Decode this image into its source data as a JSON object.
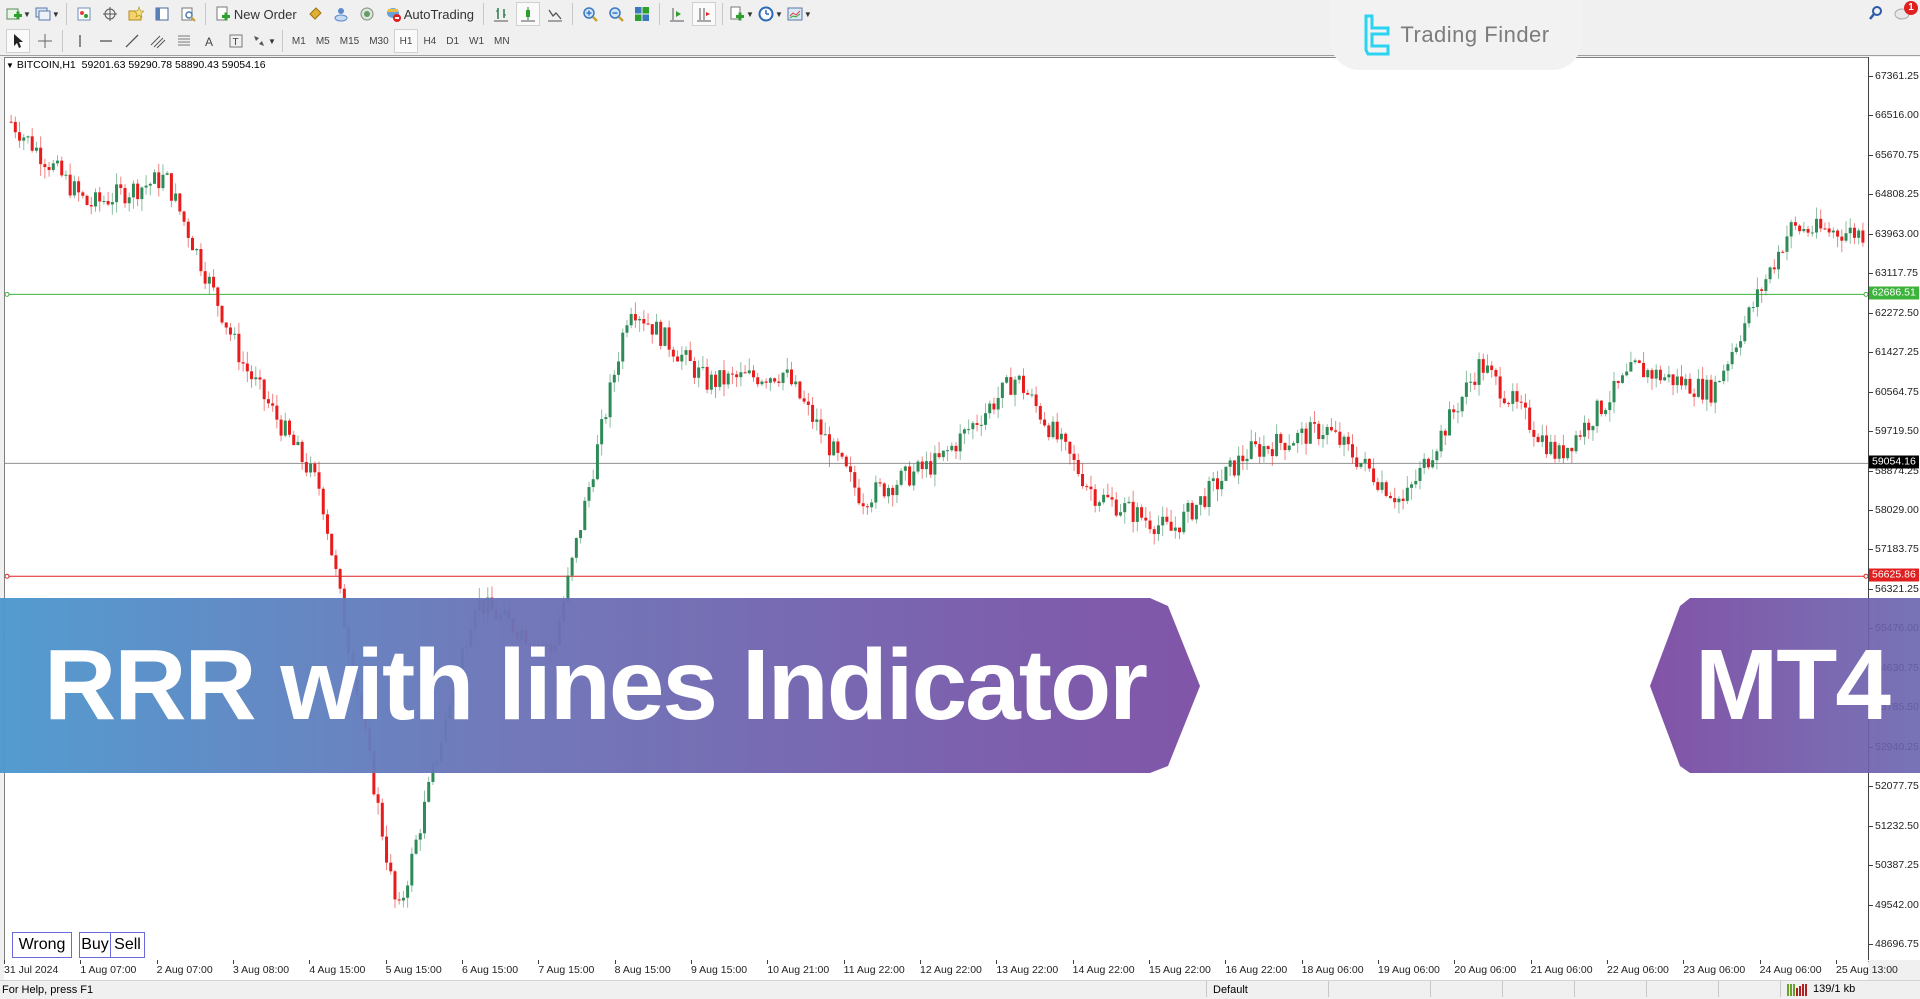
{
  "toolbar": {
    "new_order_label": "New Order",
    "autotrading_label": "AutoTrading",
    "row1_icons": [
      "new-chart-icon",
      "profiles-icon",
      "market-watch-icon",
      "navigator-icon",
      "data-window-icon",
      "terminal-icon",
      "strategy-tester-icon"
    ],
    "row1_right_icons": [
      "bar-chart-icon",
      "candlestick-icon",
      "line-chart-icon",
      "zoom-in-icon",
      "zoom-out-icon",
      "tile-windows-icon",
      "chart-shift-icon",
      "auto-scroll-icon",
      "indicators-icon",
      "periods-icon",
      "templates-icon"
    ],
    "drawing_tools": [
      "cursor-icon",
      "crosshair-icon",
      "vertical-line-icon",
      "horizontal-line-icon",
      "trendline-icon",
      "fibonacci-icon",
      "equidistant-channel-icon",
      "text-icon",
      "text-label-icon",
      "arrows-icon"
    ],
    "timeframes": [
      "M1",
      "M5",
      "M15",
      "M30",
      "H1",
      "H4",
      "D1",
      "W1",
      "MN"
    ],
    "active_timeframe": "H1"
  },
  "branding": {
    "name": "Trading Finder"
  },
  "notifications": {
    "count": "1"
  },
  "chart": {
    "symbol": "BITCOIN,H1",
    "ohlc": "59201.63 59290.78 58890.43 59054.16",
    "price_labels": [
      "67361.25",
      "66516.00",
      "65670.75",
      "64808.25",
      "63963.00",
      "63117.75",
      "62272.50",
      "61427.25",
      "60564.75",
      "59719.50",
      "58874.25",
      "58029.00",
      "57183.75",
      "56321.25",
      "55476.00",
      "54630.75",
      "53785.50",
      "52940.25",
      "52077.75",
      "51232.50",
      "50387.25",
      "49542.00",
      "48696.75"
    ],
    "time_labels": [
      "31 Jul 2024",
      "1 Aug 07:00",
      "2 Aug 07:00",
      "3 Aug 08:00",
      "4 Aug 15:00",
      "5 Aug 15:00",
      "6 Aug 15:00",
      "7 Aug 15:00",
      "8 Aug 15:00",
      "9 Aug 15:00",
      "10 Aug 21:00",
      "11 Aug 22:00",
      "12 Aug 22:00",
      "13 Aug 22:00",
      "14 Aug 22:00",
      "15 Aug 22:00",
      "16 Aug 22:00",
      "18 Aug 06:00",
      "19 Aug 06:00",
      "20 Aug 06:00",
      "21 Aug 06:00",
      "22 Aug 06:00",
      "23 Aug 06:00",
      "24 Aug 06:00",
      "25 Aug 13:00"
    ],
    "lines": {
      "take_profit": {
        "price": "62686.51",
        "color": "#3cb43c"
      },
      "current": {
        "price": "59054.16",
        "color": "#000000"
      },
      "stop_loss": {
        "price": "56625.86",
        "color": "#e02020"
      }
    },
    "colors": {
      "bull": "#2e8b57",
      "bear": "#e81c1c"
    },
    "buttons": {
      "wrong": "Wrong",
      "buy": "Buy",
      "sell": "Sell"
    }
  },
  "chart_data": {
    "type": "candlestick",
    "title": "BITCOIN,H1",
    "ylim": [
      48696.75,
      67361.25
    ],
    "x_start": "31 Jul 2024",
    "x_end": "25 Aug 13:00",
    "key_points": [
      {
        "t": "31 Jul 2024",
        "price": 66400
      },
      {
        "t": "1 Aug 07:00",
        "price": 64600
      },
      {
        "t": "2 Aug 07:00",
        "price": 65200
      },
      {
        "t": "3 Aug 08:00",
        "price": 61200
      },
      {
        "t": "4 Aug 15:00",
        "price": 58500
      },
      {
        "t": "5 Aug 15:00",
        "price": 49300
      },
      {
        "t": "6 Aug 15:00",
        "price": 56100
      },
      {
        "t": "7 Aug 15:00",
        "price": 55000
      },
      {
        "t": "8 Aug 15:00",
        "price": 62500
      },
      {
        "t": "9 Aug 15:00",
        "price": 60800
      },
      {
        "t": "10 Aug 21:00",
        "price": 61000
      },
      {
        "t": "11 Aug 22:00",
        "price": 58300
      },
      {
        "t": "12 Aug 22:00",
        "price": 59100
      },
      {
        "t": "13 Aug 22:00",
        "price": 60900
      },
      {
        "t": "14 Aug 22:00",
        "price": 58400
      },
      {
        "t": "15 Aug 22:00",
        "price": 57600
      },
      {
        "t": "16 Aug 22:00",
        "price": 59300
      },
      {
        "t": "18 Aug 06:00",
        "price": 59800
      },
      {
        "t": "19 Aug 06:00",
        "price": 58200
      },
      {
        "t": "20 Aug 06:00",
        "price": 61200
      },
      {
        "t": "21 Aug 06:00",
        "price": 59200
      },
      {
        "t": "22 Aug 06:00",
        "price": 61100
      },
      {
        "t": "23 Aug 06:00",
        "price": 60600
      },
      {
        "t": "24 Aug 06:00",
        "price": 64100
      },
      {
        "t": "25 Aug 13:00",
        "price": 64000
      }
    ]
  },
  "status_bar": {
    "help_text": "For Help, press F1",
    "profile": "Default",
    "connection": "139/1 kb"
  },
  "overlay": {
    "title": "RRR with lines Indicator",
    "platform": "MT4"
  }
}
